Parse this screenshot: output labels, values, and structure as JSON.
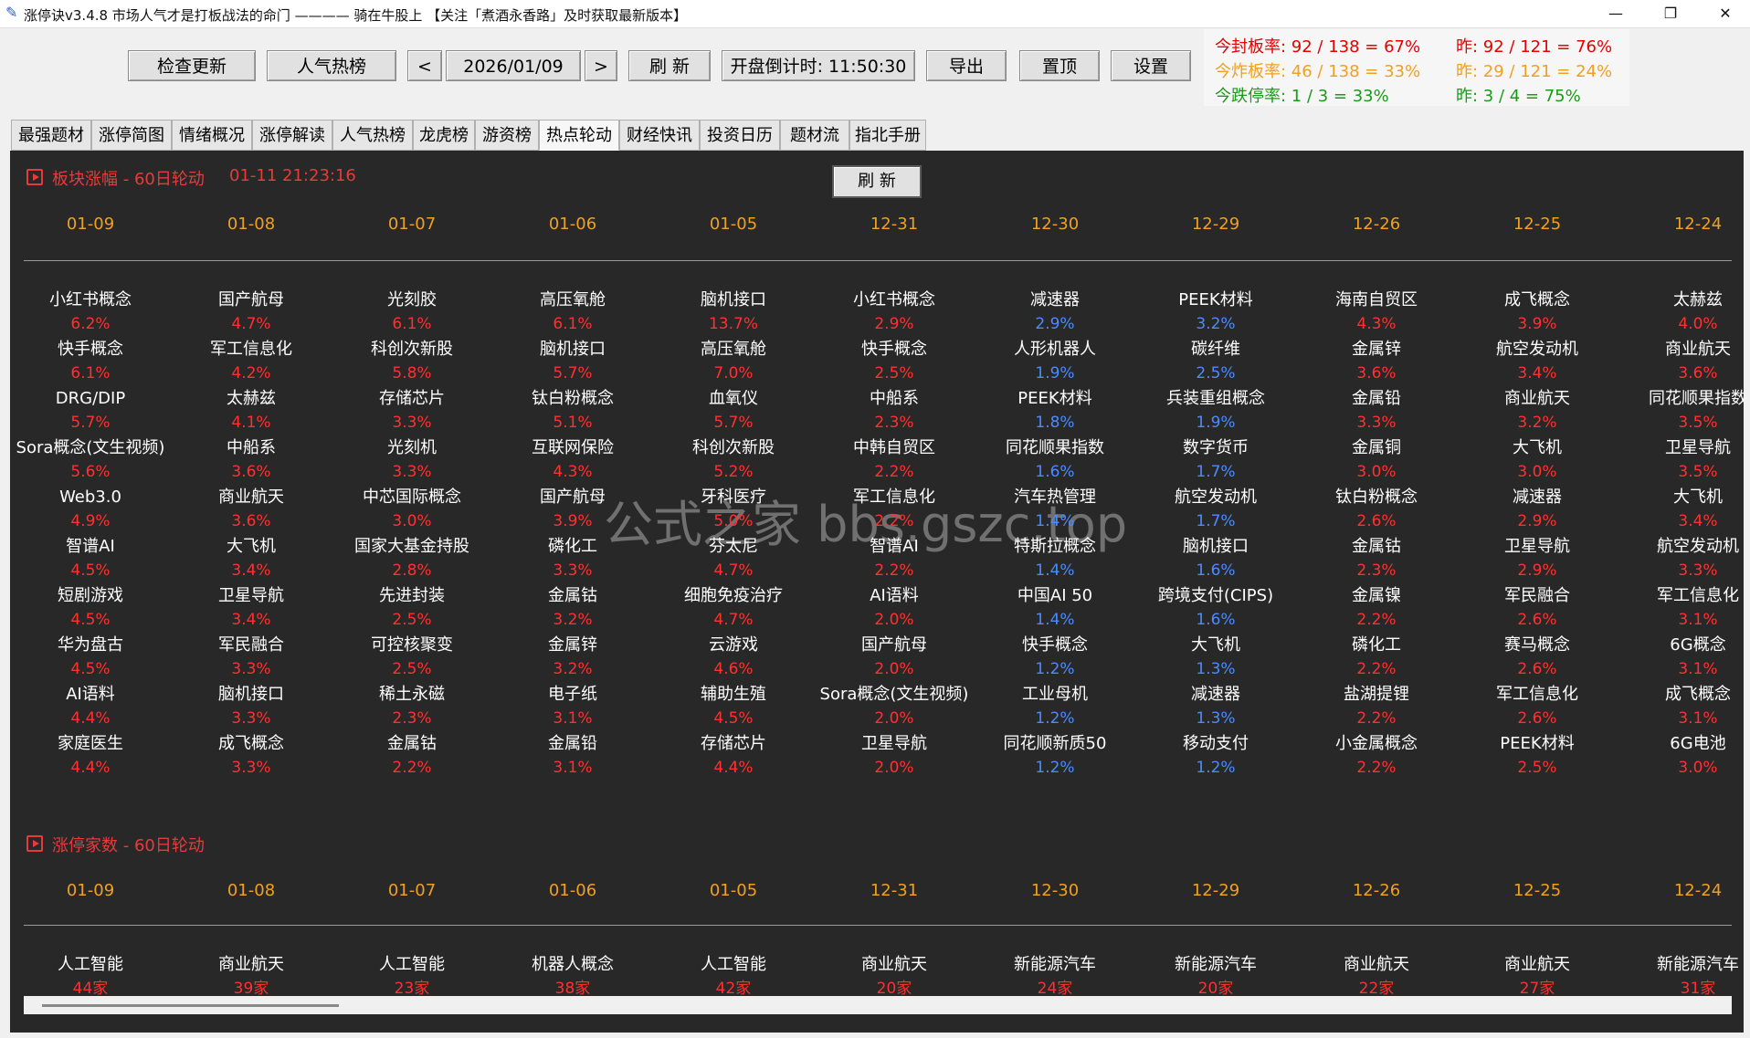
{
  "window": {
    "title": "涨停诀v3.4.8 市场人气才是打板战法的命门 ———— 骑在牛股上 【关注「煮酒永香路」及时获取最新版本】",
    "icon": "feather-icon",
    "minimize": "—",
    "restore": "❐",
    "close": "✕"
  },
  "toolbar": {
    "check_update": "检查更新",
    "popular": "人气热榜",
    "prev": "<",
    "date": "2026/01/09",
    "next": ">",
    "refresh": "刷 新",
    "countdown": "开盘倒计时: 11:50:30",
    "export": "导出",
    "pin": "置顶",
    "settings": "设置"
  },
  "stats": {
    "seal_today": "今封板率: 92 / 138 = 67%",
    "seal_yesterday": "昨: 92 / 121 = 76%",
    "burst_today": "今炸板率: 46 / 138 = 33%",
    "burst_yesterday": "昨: 29 / 121 = 24%",
    "drop_today": "今跌停率: 1 / 3 = 33%",
    "drop_yesterday": "昨: 3 / 4 = 75%",
    "colors": {
      "red": "#e60000",
      "orange": "#f0a020",
      "green": "#1a9a1a"
    }
  },
  "tabs": [
    "最强题材",
    "涨停简图",
    "情绪概况",
    "涨停解读",
    "人气热榜",
    "龙虎榜",
    "游资榜",
    "热点轮动",
    "财经快讯",
    "投资日历",
    "题材流",
    "指北手册"
  ],
  "active_tab": "热点轮动",
  "section1": {
    "title": "板块涨幅 - 60日轮动",
    "timestamp": "01-11 21:23:16",
    "refresh": "刷 新",
    "dates": [
      "01-09",
      "01-08",
      "01-07",
      "01-06",
      "01-05",
      "12-31",
      "12-30",
      "12-29",
      "12-26",
      "12-25",
      "12-24"
    ],
    "columns": [
      [
        [
          "小红书概念",
          "6.2%"
        ],
        [
          "快手概念",
          "6.1%"
        ],
        [
          "DRG/DIP",
          "5.7%"
        ],
        [
          "Sora概念(文生视频)",
          "5.6%"
        ],
        [
          "Web3.0",
          "4.9%"
        ],
        [
          "智谱AI",
          "4.5%"
        ],
        [
          "短剧游戏",
          "4.5%"
        ],
        [
          "华为盘古",
          "4.5%"
        ],
        [
          "AI语料",
          "4.4%"
        ],
        [
          "家庭医生",
          "4.4%"
        ]
      ],
      [
        [
          "国产航母",
          "4.7%"
        ],
        [
          "军工信息化",
          "4.2%"
        ],
        [
          "太赫兹",
          "4.1%"
        ],
        [
          "中船系",
          "3.6%"
        ],
        [
          "商业航天",
          "3.6%"
        ],
        [
          "大飞机",
          "3.4%"
        ],
        [
          "卫星导航",
          "3.4%"
        ],
        [
          "军民融合",
          "3.3%"
        ],
        [
          "脑机接口",
          "3.3%"
        ],
        [
          "成飞概念",
          "3.3%"
        ]
      ],
      [
        [
          "光刻胶",
          "6.1%"
        ],
        [
          "科创次新股",
          "5.8%"
        ],
        [
          "存储芯片",
          "3.3%"
        ],
        [
          "光刻机",
          "3.3%"
        ],
        [
          "中芯国际概念",
          "3.0%"
        ],
        [
          "国家大基金持股",
          "2.8%"
        ],
        [
          "先进封装",
          "2.5%"
        ],
        [
          "可控核聚变",
          "2.5%"
        ],
        [
          "稀土永磁",
          "2.3%"
        ],
        [
          "金属钴",
          "2.2%"
        ]
      ],
      [
        [
          "高压氧舱",
          "6.1%"
        ],
        [
          "脑机接口",
          "5.7%"
        ],
        [
          "钛白粉概念",
          "5.1%"
        ],
        [
          "互联网保险",
          "4.3%"
        ],
        [
          "国产航母",
          "3.9%"
        ],
        [
          "磷化工",
          "3.3%"
        ],
        [
          "金属钴",
          "3.2%"
        ],
        [
          "金属锌",
          "3.2%"
        ],
        [
          "电子纸",
          "3.1%"
        ],
        [
          "金属铅",
          "3.1%"
        ]
      ],
      [
        [
          "脑机接口",
          "13.7%"
        ],
        [
          "高压氧舱",
          "7.0%"
        ],
        [
          "血氧仪",
          "5.7%"
        ],
        [
          "科创次新股",
          "5.2%"
        ],
        [
          "牙科医疗",
          "5.0%"
        ],
        [
          "芬太尼",
          "4.7%"
        ],
        [
          "细胞免疫治疗",
          "4.7%"
        ],
        [
          "云游戏",
          "4.6%"
        ],
        [
          "辅助生殖",
          "4.5%"
        ],
        [
          "存储芯片",
          "4.4%"
        ]
      ],
      [
        [
          "小红书概念",
          "2.9%"
        ],
        [
          "快手概念",
          "2.5%"
        ],
        [
          "中船系",
          "2.3%"
        ],
        [
          "中韩自贸区",
          "2.2%"
        ],
        [
          "军工信息化",
          "2.2%"
        ],
        [
          "智谱AI",
          "2.2%"
        ],
        [
          "AI语料",
          "2.0%"
        ],
        [
          "国产航母",
          "2.0%"
        ],
        [
          "Sora概念(文生视频)",
          "2.0%"
        ],
        [
          "卫星导航",
          "2.0%"
        ]
      ],
      [
        [
          "减速器",
          "2.9%"
        ],
        [
          "人形机器人",
          "1.9%"
        ],
        [
          "PEEK材料",
          "1.8%"
        ],
        [
          "同花顺果指数",
          "1.6%"
        ],
        [
          "汽车热管理",
          "1.4%"
        ],
        [
          "特斯拉概念",
          "1.4%"
        ],
        [
          "中国AI 50",
          "1.4%"
        ],
        [
          "快手概念",
          "1.2%"
        ],
        [
          "工业母机",
          "1.2%"
        ],
        [
          "同花顺新质50",
          "1.2%"
        ]
      ],
      [
        [
          "PEEK材料",
          "3.2%"
        ],
        [
          "碳纤维",
          "2.5%"
        ],
        [
          "兵装重组概念",
          "1.9%"
        ],
        [
          "数字货币",
          "1.7%"
        ],
        [
          "航空发动机",
          "1.7%"
        ],
        [
          "脑机接口",
          "1.6%"
        ],
        [
          "跨境支付(CIPS)",
          "1.6%"
        ],
        [
          "大飞机",
          "1.3%"
        ],
        [
          "减速器",
          "1.3%"
        ],
        [
          "移动支付",
          "1.2%"
        ]
      ],
      [
        [
          "海南自贸区",
          "4.3%"
        ],
        [
          "金属锌",
          "3.6%"
        ],
        [
          "金属铅",
          "3.3%"
        ],
        [
          "金属铜",
          "3.0%"
        ],
        [
          "钛白粉概念",
          "2.6%"
        ],
        [
          "金属钴",
          "2.3%"
        ],
        [
          "金属镍",
          "2.2%"
        ],
        [
          "磷化工",
          "2.2%"
        ],
        [
          "盐湖提锂",
          "2.2%"
        ],
        [
          "小金属概念",
          "2.2%"
        ]
      ],
      [
        [
          "成飞概念",
          "3.9%"
        ],
        [
          "航空发动机",
          "3.4%"
        ],
        [
          "商业航天",
          "3.2%"
        ],
        [
          "大飞机",
          "3.0%"
        ],
        [
          "减速器",
          "2.9%"
        ],
        [
          "卫星导航",
          "2.9%"
        ],
        [
          "军民融合",
          "2.6%"
        ],
        [
          "赛马概念",
          "2.6%"
        ],
        [
          "军工信息化",
          "2.6%"
        ],
        [
          "PEEK材料",
          "2.5%"
        ]
      ],
      [
        [
          "太赫兹",
          "4.0%"
        ],
        [
          "商业航天",
          "3.6%"
        ],
        [
          "同花顺果指数",
          "3.5%"
        ],
        [
          "卫星导航",
          "3.5%"
        ],
        [
          "大飞机",
          "3.4%"
        ],
        [
          "航空发动机",
          "3.3%"
        ],
        [
          "军工信息化",
          "3.1%"
        ],
        [
          "6G概念",
          "3.1%"
        ],
        [
          "成飞概念",
          "3.1%"
        ],
        [
          "6G电池",
          "3.0%"
        ]
      ]
    ],
    "value_colors": [
      "red",
      "red",
      "red",
      "red",
      "red",
      "red",
      "blue",
      "blue",
      "red",
      "red",
      "red"
    ]
  },
  "section2": {
    "title": "涨停家数 - 60日轮动",
    "dates": [
      "01-09",
      "01-08",
      "01-07",
      "01-06",
      "01-05",
      "12-31",
      "12-30",
      "12-29",
      "12-26",
      "12-25",
      "12-24"
    ],
    "columns": [
      [
        [
          "人工智能",
          "44家"
        ]
      ],
      [
        [
          "商业航天",
          "39家"
        ]
      ],
      [
        [
          "人工智能",
          "23家"
        ]
      ],
      [
        [
          "机器人概念",
          "38家"
        ]
      ],
      [
        [
          "人工智能",
          "42家"
        ]
      ],
      [
        [
          "商业航天",
          "20家"
        ]
      ],
      [
        [
          "新能源汽车",
          "24家"
        ]
      ],
      [
        [
          "新能源汽车",
          "20家"
        ]
      ],
      [
        [
          "商业航天",
          "22家"
        ]
      ],
      [
        [
          "商业航天",
          "27家"
        ]
      ],
      [
        [
          "新能源汽车",
          "31家"
        ]
      ]
    ]
  },
  "watermark": "公式之家 bbs.gszc.top",
  "palette": {
    "red": "#ff3030",
    "blue": "#4a8cff",
    "date": "#f0a020",
    "panel": "#282828"
  }
}
